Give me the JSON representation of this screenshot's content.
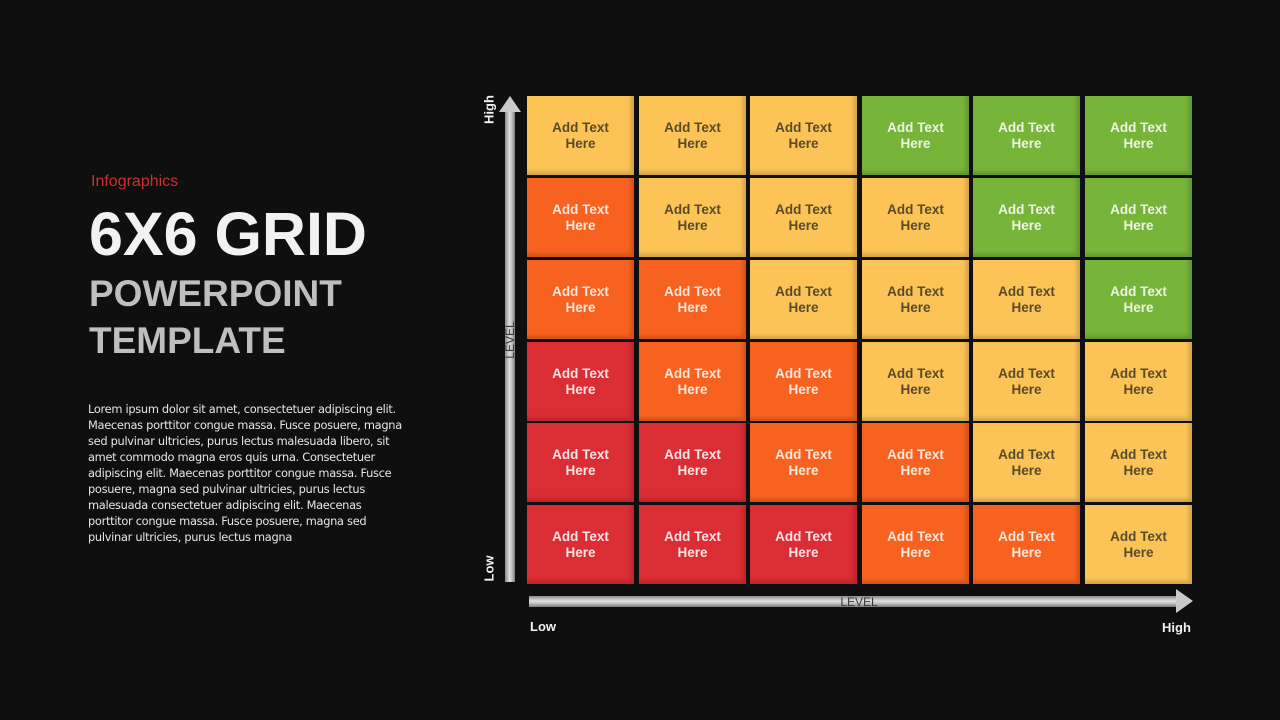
{
  "header": {
    "eyebrow": "Infographics",
    "title": "6X6 GRID",
    "subtitle_line1": "POWERPOINT",
    "subtitle_line2": "TEMPLATE"
  },
  "body_text": "Lorem ipsum dolor sit amet, consectetuer adipiscing elit. Maecenas porttitor congue massa. Fusce posuere, magna sed pulvinar ultricies, purus lectus malesuada libero, sit amet commodo magna eros quis urna. Consectetuer adipiscing elit. Maecenas porttitor congue massa. Fusce posuere, magna sed pulvinar ultricies, purus lectus malesuada consectetuer adipiscing elit. Maecenas porttitor congue massa. Fusce posuere, magna sed pulvinar ultricies, purus lectus magna",
  "axes": {
    "y": {
      "name": "LEVEL",
      "high": "High",
      "low": "Low"
    },
    "x": {
      "name": "LEVEL",
      "low": "Low",
      "high": "High"
    }
  },
  "colors": {
    "yellow": "#fcc457",
    "green": "#77b43a",
    "orange": "#f86220",
    "red": "#db2d34",
    "accent": "#c8312e"
  },
  "grid": {
    "cell_text_line1": "Add Text",
    "cell_text_line2": "Here",
    "rows": [
      [
        "yellow",
        "yellow",
        "yellow",
        "green",
        "green",
        "green"
      ],
      [
        "orange",
        "yellow",
        "yellow",
        "yellow",
        "green",
        "green"
      ],
      [
        "orange",
        "orange",
        "yellow",
        "yellow",
        "yellow",
        "green"
      ],
      [
        "red",
        "orange",
        "orange",
        "yellow",
        "yellow",
        "yellow"
      ],
      [
        "red",
        "red",
        "orange",
        "orange",
        "yellow",
        "yellow"
      ],
      [
        "red",
        "red",
        "red",
        "orange",
        "orange",
        "yellow"
      ]
    ]
  }
}
